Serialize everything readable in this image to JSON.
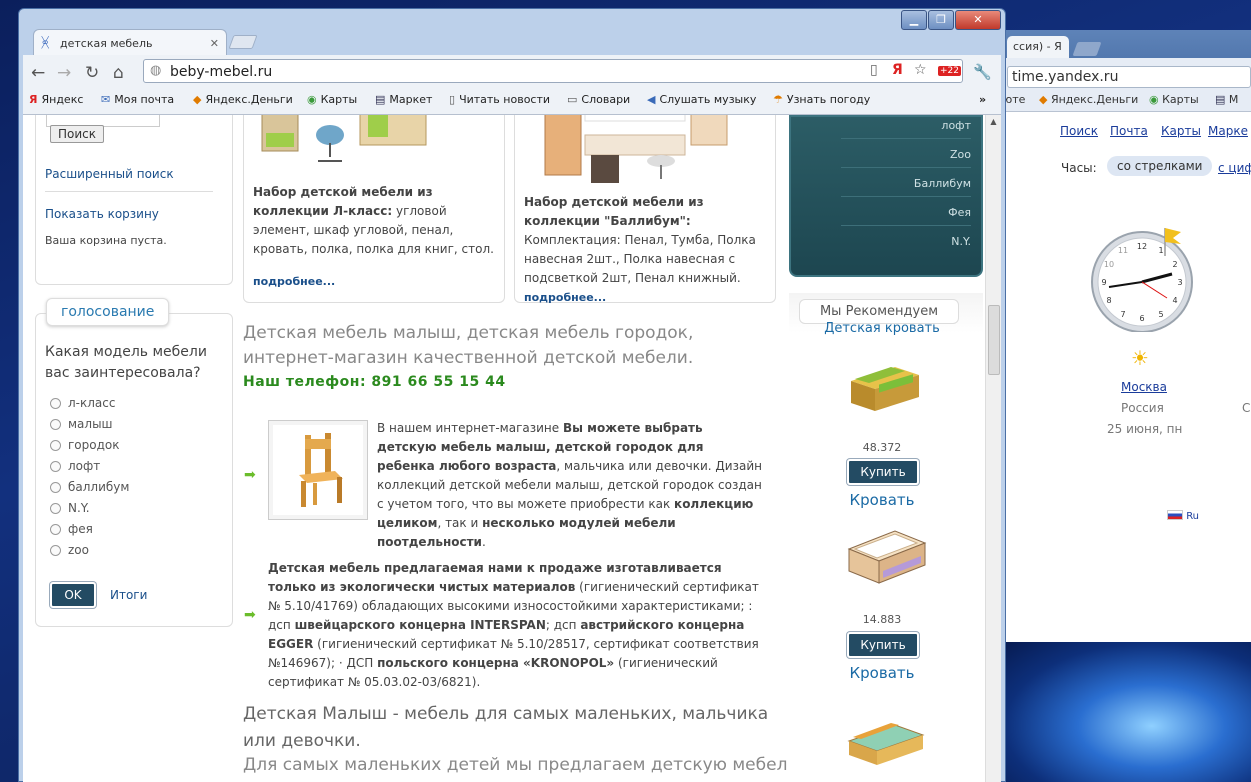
{
  "back_window": {
    "tab_title": "ссия) - Я",
    "url": "time.yandex.ru",
    "bookmarks": [
      "юте",
      "Яндекс.Деньги",
      "Карты",
      "М"
    ],
    "links": [
      "Поиск",
      "Почта",
      "Карты",
      "Марке"
    ],
    "clock_label": "Часы:",
    "clock_opt_selected": "со стрелками",
    "clock_opt_other": "с циф",
    "clock_numbers": [
      "12",
      "1",
      "2",
      "3",
      "4",
      "5",
      "6",
      "7",
      "8",
      "9",
      "10",
      "11"
    ],
    "city": "Москва",
    "country": "Россия",
    "country_cut": "С",
    "date": "25 июня, пн",
    "lang": "Ru"
  },
  "window": {
    "tab_title": "детская мебель",
    "url": "beby-mebel.ru",
    "ext_badge": "+22",
    "controls": {
      "min": "▁",
      "max": "❐",
      "close": "✕"
    },
    "bookmarks": [
      {
        "icon": "Я",
        "label": "Яндекс"
      },
      {
        "icon": "✉",
        "label": "Моя почта"
      },
      {
        "icon": "◆",
        "label": "Яндекс.Деньги"
      },
      {
        "icon": "◉",
        "label": "Карты"
      },
      {
        "icon": "▤",
        "label": "Маркет"
      },
      {
        "icon": "▯",
        "label": "Читать новости"
      },
      {
        "icon": "▭",
        "label": "Словари"
      },
      {
        "icon": "◀",
        "label": "Слушать музыку"
      },
      {
        "icon": "☂",
        "label": "Узнать погоду"
      }
    ],
    "bookmarks_more": "»"
  },
  "sidebar": {
    "search_button": "Поиск",
    "advanced_search": "Расширенный поиск",
    "show_cart": "Показать корзину",
    "cart_empty": "Ваша корзина пуста.",
    "poll_title": "голосование",
    "poll_question": "Какая модель мебели вас заинтересовала?",
    "poll_options": [
      "л-класс",
      "малыш",
      "городок",
      "лофт",
      "баллибум",
      "N.Y.",
      "фея",
      "zoo"
    ],
    "ok_button": "OK",
    "results_link": "Итоги"
  },
  "cards": [
    {
      "title_bold": "Набор детской мебели из коллекции Л-класс:",
      "desc": "угловой элемент, шкаф угловой, пенал, кровать, полка, полка для книг, стол.",
      "more": "подробнее..."
    },
    {
      "title_bold": "Набор детской мебели из коллекции \"Баллибум\":",
      "desc": "Комплектация: Пенал, Тумба, Полка навесная 2шт., Полка навесная с подсветкой 2шт, Пенал книжный.",
      "more": "подробнее..."
    }
  ],
  "main": {
    "heading": "Детская мебель малыш, детская мебель городок, интернет-магазин качественной детской мебели.",
    "phone": "Наш телефон: 891 66 55 15 44",
    "para1": {
      "a": "В нашем интернет-магазине ",
      "b": "Вы можете выбрать детскую мебель малыш, детской городок для ребенка любого возраста",
      "c": ", мальчика или девочки. Дизайн коллекций детской мебели малыш, детской городок создан с учетом того, что вы можете приобрести как ",
      "d": "коллекцию целиком",
      "e": ", так и ",
      "f": "несколько модулей мебели поотдельности",
      "g": "."
    },
    "para2": {
      "a": "Детская мебель предлагаемая нами к продаже изготавливается только из экологически чистых материалов",
      "b": " (гигиенический сертификат № 5.10/41769) обладающих высокими износостойкими характеристиками; : дсп ",
      "c": "швейцарского концерна INTERSPAN",
      "d": "; дсп ",
      "e": "австрийского концерна EGGER",
      "f": " (гигиенический сертификат № 5.10/28517, сертификат соответствия №146967); · ДСП ",
      "g": "польского концерна «KRONOPOL»",
      "h": " (гигиенический сертификат № 05.03.02-03/6821)."
    },
    "heading2": "Детская Малыш - мебель для самых маленьких, мальчика или девочки.",
    "para3": "Для самых маленьких детей мы предлагаем детскую мебель"
  },
  "right": {
    "menu": [
      "лофт",
      "Zoo",
      "Баллибум",
      "Фея",
      "N.Y."
    ],
    "rec_title": "Мы Рекомендуем",
    "rec_sub": "Детская кровать",
    "products": [
      {
        "price": "48.372",
        "buy": "Купить",
        "name": "Кровать"
      },
      {
        "price": "14.883",
        "buy": "Купить",
        "name": "Кровать"
      }
    ]
  }
}
